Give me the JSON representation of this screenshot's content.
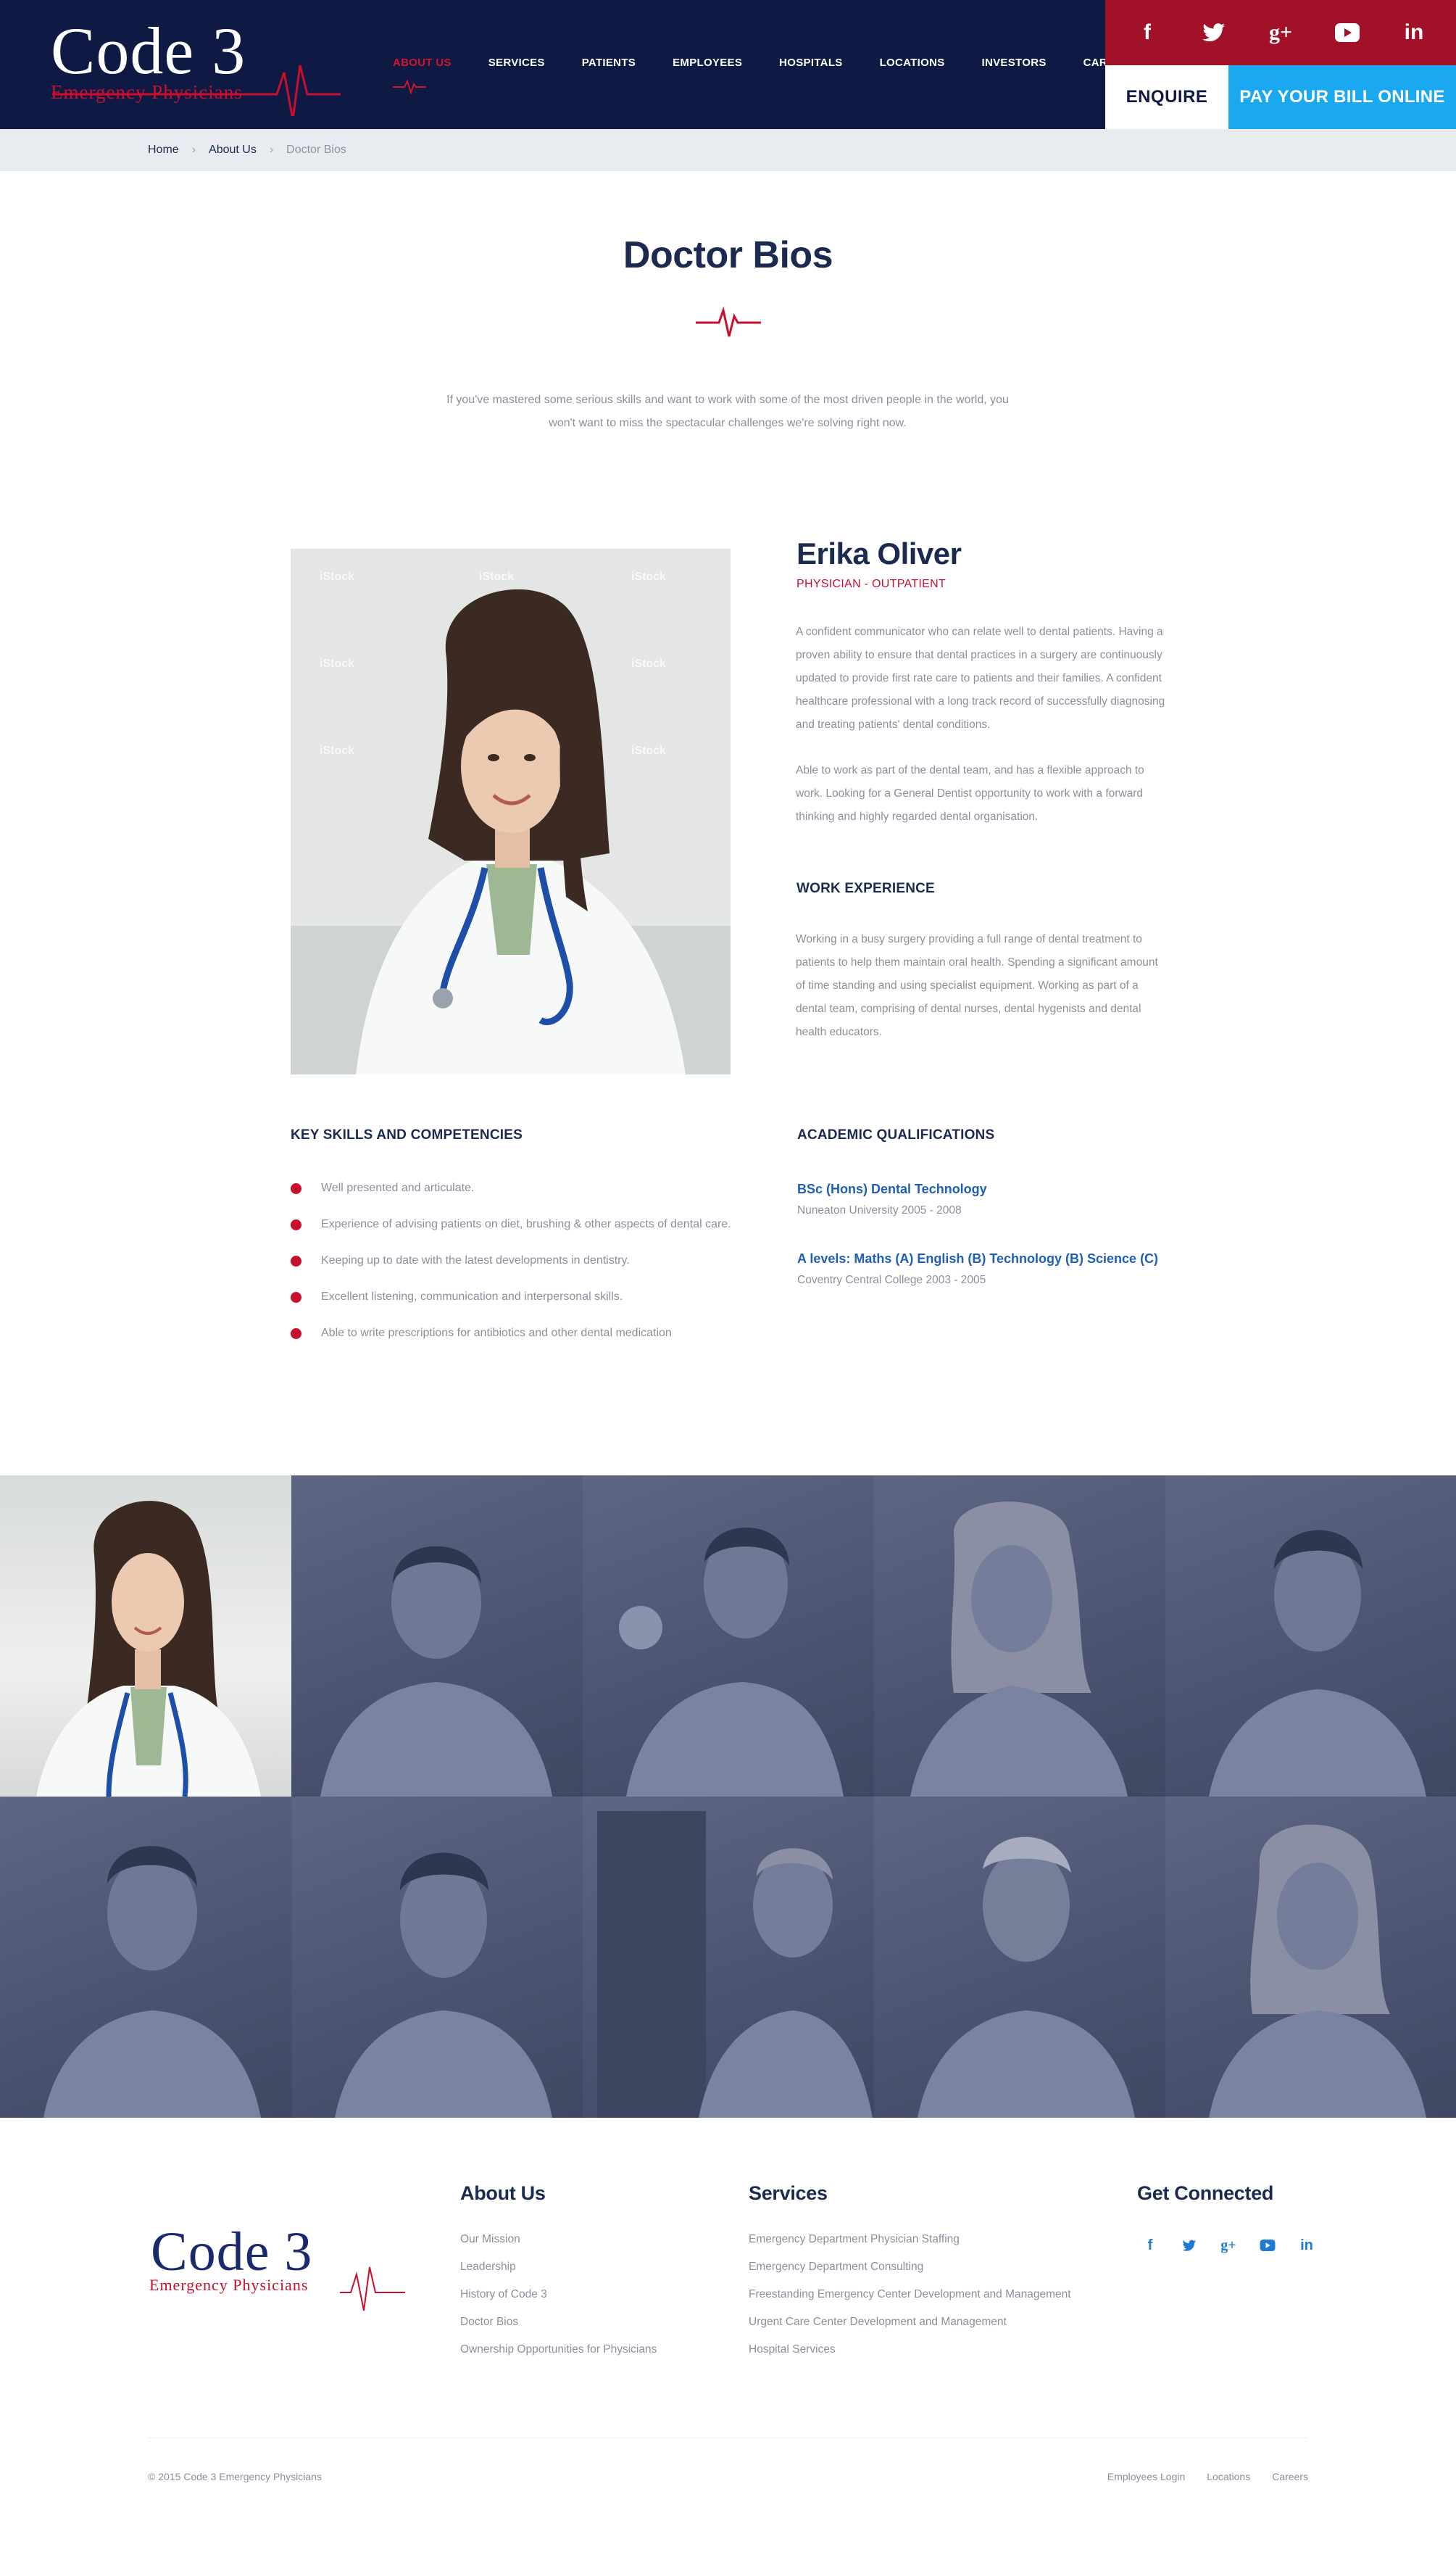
{
  "brand": {
    "name_main": "Code 3",
    "name_sub": "Emergency Physicians"
  },
  "nav": {
    "items": [
      {
        "label": "ABOUT US",
        "active": true
      },
      {
        "label": "SERVICES"
      },
      {
        "label": "PATIENTS"
      },
      {
        "label": "EMPLOYEES"
      },
      {
        "label": "HOSPITALS"
      },
      {
        "label": "LOCATIONS"
      },
      {
        "label": "INVESTORS"
      },
      {
        "label": "CAREERS"
      }
    ]
  },
  "social": {
    "icons": [
      "facebook-icon",
      "twitter-icon",
      "google-plus-icon",
      "youtube-icon",
      "linkedin-icon"
    ],
    "glyphs": [
      "f",
      "t",
      "g+",
      "▶",
      "in"
    ]
  },
  "header_buttons": {
    "enquire": "ENQUIRE",
    "pay": "PAY YOUR BILL ONLINE"
  },
  "breadcrumb": {
    "home": "Home",
    "about": "About Us",
    "current": "Doctor Bios",
    "separator": "›"
  },
  "page": {
    "title": "Doctor Bios",
    "intro": "If you've mastered some serious skills and want to work with some of the most driven people in the world, you won't want to miss the spectacular challenges we're solving right now."
  },
  "profile": {
    "name": "Erika Oliver",
    "role": "PHYSICIAN - OUTPATIENT",
    "bio_1": "A confident communicator who can relate well to dental patients. Having a proven ability to ensure that dental practices in a surgery are continuously updated to provide first rate care to patients and their families. A confident healthcare professional with a long track record of successfully diagnosing and treating patients' dental conditions.",
    "bio_2": "Able to work as part of the dental team, and has a flexible approach to work. Looking for a General Dentist opportunity to work with a forward thinking and highly regarded dental organisation.",
    "work_heading": "WORK EXPERIENCE",
    "work_text": "Working in a busy surgery providing a full range of dental treatment to patients to help them maintain oral health. Spending a significant amount of time standing and using specialist equipment. Working as part of a dental team, comprising of dental nurses, dental hygenists and dental health educators.",
    "watermark": "iStock"
  },
  "skills": {
    "heading": "KEY SKILLS AND COMPETENCIES",
    "items": [
      "Well presented and articulate.",
      "Experience of advising patients on diet, brushing & other aspects of dental care.",
      " Keeping up to date with the latest developments in dentistry.",
      "Excellent listening, communication and interpersonal skills.",
      "Able to write prescriptions for antibiotics and other dental medication"
    ]
  },
  "academic": {
    "heading": "ACADEMIC QUALIFICATIONS",
    "items": [
      {
        "title": "BSc (Hons) Dental Technology",
        "sub": "Nuneaton University 2005 - 2008"
      },
      {
        "title": "A levels: Maths (A) English (B) Technology (B) Science (C)",
        "sub": "Coventry Central College 2003 - 2005"
      }
    ]
  },
  "footer": {
    "about_heading": "About Us",
    "about_links": [
      "Our Mission",
      "Leadership",
      "History of Code 3",
      "Doctor Bios",
      "Ownership Opportunities for Physicians"
    ],
    "services_heading": "Services",
    "services_links": [
      "Emergency Department Physician Staffing",
      "Emergency Department Consulting",
      "Freestanding Emergency Center Development and Management",
      "Urgent Care Center Development and Management",
      "Hospital Services"
    ],
    "connect_heading": "Get Connected",
    "copyright": "© 2015 Code 3 Emergency Physicians",
    "bottom_links": [
      "Employees Login",
      "Locations",
      "Careers"
    ]
  },
  "colors": {
    "navy": "#0e1a44",
    "red": "#c8102e",
    "social_bar": "#a11228",
    "pay_blue": "#1aa8f0",
    "link_blue": "#1f5fb5"
  }
}
